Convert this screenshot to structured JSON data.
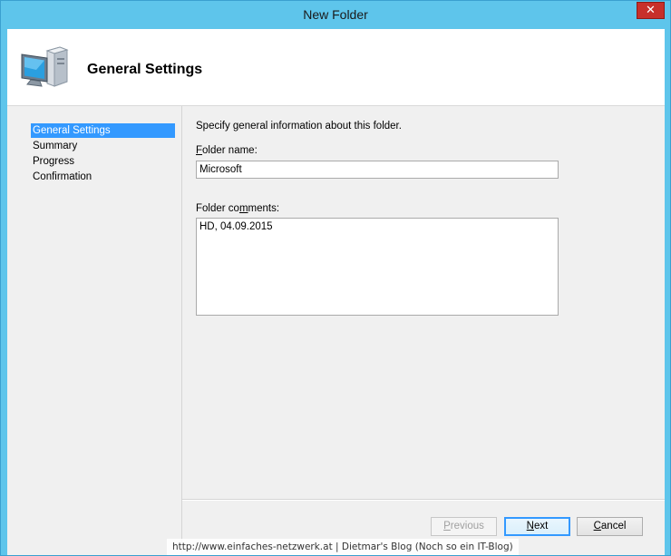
{
  "window": {
    "title": "New Folder",
    "close_glyph": "✕"
  },
  "header": {
    "title": "General Settings",
    "icon": "computer-icon"
  },
  "nav": {
    "items": [
      {
        "label": "General Settings",
        "active": true
      },
      {
        "label": "Summary",
        "active": false
      },
      {
        "label": "Progress",
        "active": false
      },
      {
        "label": "Confirmation",
        "active": false
      }
    ]
  },
  "content": {
    "intro": "Specify general information about this folder.",
    "folder_name": {
      "label_accel": "F",
      "label_rest": "older name:",
      "value": "Microsoft"
    },
    "folder_comments": {
      "label_pre": "Folder co",
      "label_accel": "m",
      "label_post": "ments:",
      "value": "HD, 04.09.2015"
    }
  },
  "buttons": {
    "previous": {
      "accel": "P",
      "rest": "revious"
    },
    "next": {
      "accel": "N",
      "rest": "ext"
    },
    "cancel": {
      "accel": "C",
      "rest": "ancel"
    }
  },
  "watermark": "http://www.einfaches-netzwerk.at | Dietmar's Blog (Noch so ein IT-Blog)"
}
